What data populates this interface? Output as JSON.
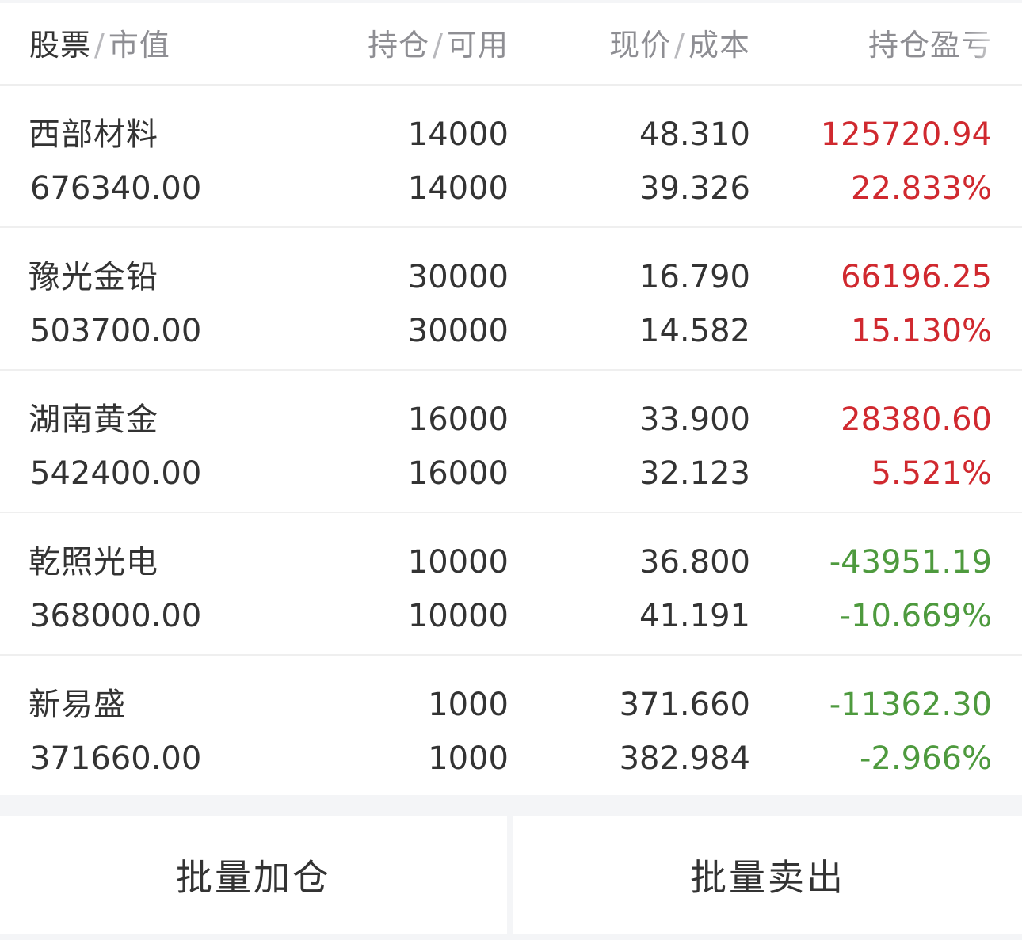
{
  "header": {
    "col1_primary": "股票",
    "col1_secondary": "市值",
    "col2_primary": "持仓",
    "col2_secondary": "可用",
    "col3_primary": "现价",
    "col3_secondary": "成本",
    "col4_primary": "持仓盈亏",
    "separator": "/"
  },
  "colors": {
    "profit": "#d0292f",
    "loss": "#4e9a3e"
  },
  "holdings": [
    {
      "name": "西部材料",
      "market_value": "676340.00",
      "position": "14000",
      "available": "14000",
      "price": "48.310",
      "cost": "39.326",
      "pnl": "125720.94",
      "pnl_pct": "22.833%",
      "trend": "up"
    },
    {
      "name": "豫光金铅",
      "market_value": "503700.00",
      "position": "30000",
      "available": "30000",
      "price": "16.790",
      "cost": "14.582",
      "pnl": "66196.25",
      "pnl_pct": "15.130%",
      "trend": "up"
    },
    {
      "name": "湖南黄金",
      "market_value": "542400.00",
      "position": "16000",
      "available": "16000",
      "price": "33.900",
      "cost": "32.123",
      "pnl": "28380.60",
      "pnl_pct": "5.521%",
      "trend": "up"
    },
    {
      "name": "乾照光电",
      "market_value": "368000.00",
      "position": "10000",
      "available": "10000",
      "price": "36.800",
      "cost": "41.191",
      "pnl": "-43951.19",
      "pnl_pct": "-10.669%",
      "trend": "down"
    },
    {
      "name": "新易盛",
      "market_value": "371660.00",
      "position": "1000",
      "available": "1000",
      "price": "371.660",
      "cost": "382.984",
      "pnl": "-11362.30",
      "pnl_pct": "-2.966%",
      "trend": "down"
    }
  ],
  "actions": {
    "batch_add": "批量加仓",
    "batch_sell": "批量卖出"
  }
}
